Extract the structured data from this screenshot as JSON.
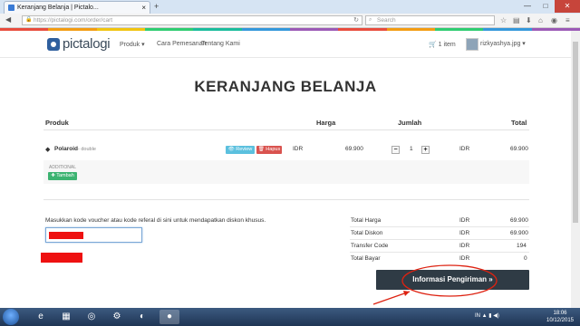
{
  "browser": {
    "tab_title": "Keranjang Belanja | Pictalo...",
    "tab_close": "×",
    "new_tab": "+",
    "url": "https://pictalogi.com/order/cart",
    "search_placeholder": "Search",
    "window_controls": [
      "—",
      "□",
      "✕"
    ]
  },
  "site": {
    "logo": "pictalogi",
    "menu": [
      "Produk ▾",
      "Cara Pemesanan",
      "Tentang Kami"
    ],
    "cart_label": "1 item",
    "user_name": "rizkyashya.jpg ▾",
    "rainbow_colors": [
      "#e84c3d",
      "#f39c12",
      "#f1c40f",
      "#2ecc71",
      "#1abc9c",
      "#3498db",
      "#9b59b6",
      "#e84c3d",
      "#f39c12",
      "#2ecc71",
      "#3498db",
      "#9b59b6"
    ]
  },
  "page": {
    "title": "KERANJANG BELANJA",
    "headers": {
      "product": "Produk",
      "price": "Harga",
      "qty": "Jumlah",
      "total": "Total"
    },
    "item": {
      "name": "Polaroid",
      "variant": "- double",
      "review_label": "👁 Review",
      "delete_label": "🗑 Hapus",
      "price_currency": "IDR",
      "price": "69.900",
      "qty": "1",
      "total_currency": "IDR",
      "total": "69.900"
    },
    "additional_label": "ADDITIONAL",
    "add_label": "✚ Tambah",
    "voucher_prompt": "Masukkan kode voucher atau kode referal di sini untuk mendapatkan diskon khusus.",
    "summary": [
      {
        "label": "Total Harga",
        "currency": "IDR",
        "value": "69.900"
      },
      {
        "label": "Total Diskon",
        "currency": "IDR",
        "value": "69.900"
      },
      {
        "label": "Transfer Code",
        "currency": "IDR",
        "value": "194"
      },
      {
        "label": "Total Bayar",
        "currency": "IDR",
        "value": "0"
      }
    ],
    "shipping_button": "Informasi Pengiriman  »"
  },
  "taskbar": {
    "apps": [
      "e",
      "▦",
      "◎",
      "⚙",
      "◐",
      "●"
    ],
    "tray": "IN  ▲ ▮ ◀)",
    "time": "18:06",
    "date": "10/12/2015"
  }
}
